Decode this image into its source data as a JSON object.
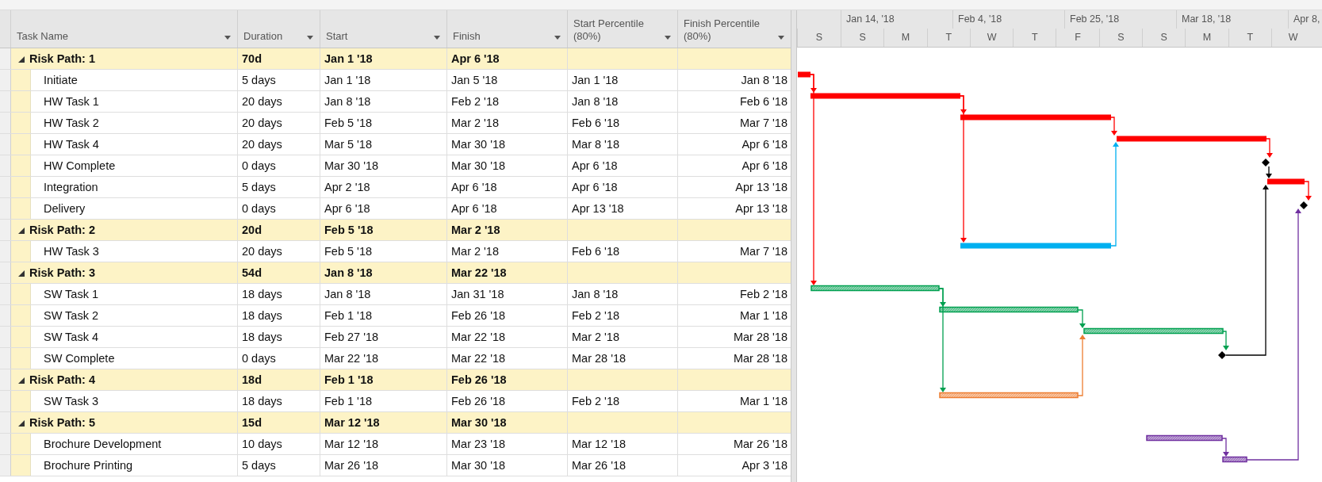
{
  "columns": [
    {
      "label": "Task Name"
    },
    {
      "label": "Duration"
    },
    {
      "label": "Start"
    },
    {
      "label": "Finish"
    },
    {
      "label": "Start Percentile",
      "sublabel": "(80%)"
    },
    {
      "label": "Finish Percentile",
      "sublabel": "(80%)"
    }
  ],
  "timescale": {
    "major": [
      "Jan 14, '18",
      "Feb 4, '18",
      "Feb 25, '18",
      "Mar 18, '18",
      "Apr 8,"
    ],
    "minor": [
      "S",
      "S",
      "M",
      "T",
      "W",
      "T",
      "F",
      "S",
      "S",
      "M",
      "T",
      "W"
    ]
  },
  "groups": [
    {
      "name": "Risk Path: 1",
      "duration": "70d",
      "start": "Jan 1 '18",
      "finish": "Apr 6 '18",
      "expanded": true,
      "color": "#ff0000",
      "hatched": false,
      "tasks": [
        {
          "name": "Initiate",
          "duration": "5 days",
          "start": "Jan 1 '18",
          "finish": "Jan 5 '18",
          "start_percentile": "Jan 1 '18",
          "finish_percentile": "Jan 8 '18"
        },
        {
          "name": "HW Task 1",
          "duration": "20 days",
          "start": "Jan 8 '18",
          "finish": "Feb 2 '18",
          "start_percentile": "Jan 8 '18",
          "finish_percentile": "Feb 6 '18"
        },
        {
          "name": "HW Task 2",
          "duration": "20 days",
          "start": "Feb 5 '18",
          "finish": "Mar 2 '18",
          "start_percentile": "Feb 6 '18",
          "finish_percentile": "Mar 7 '18"
        },
        {
          "name": "HW Task 4",
          "duration": "20 days",
          "start": "Mar 5 '18",
          "finish": "Mar 30 '18",
          "start_percentile": "Mar 8 '18",
          "finish_percentile": "Apr 6 '18"
        },
        {
          "name": "HW Complete",
          "duration": "0 days",
          "start": "Mar 30 '18",
          "finish": "Mar 30 '18",
          "start_percentile": "Apr 6 '18",
          "finish_percentile": "Apr 6 '18"
        },
        {
          "name": "Integration",
          "duration": "5 days",
          "start": "Apr 2 '18",
          "finish": "Apr 6 '18",
          "start_percentile": "Apr 6 '18",
          "finish_percentile": "Apr 13 '18"
        },
        {
          "name": "Delivery",
          "duration": "0 days",
          "start": "Apr 6 '18",
          "finish": "Apr 6 '18",
          "start_percentile": "Apr 13 '18",
          "finish_percentile": "Apr 13 '18"
        }
      ]
    },
    {
      "name": "Risk Path: 2",
      "duration": "20d",
      "start": "Feb 5 '18",
      "finish": "Mar 2 '18",
      "expanded": true,
      "color": "#00b0f0",
      "hatched": false,
      "tasks": [
        {
          "name": "HW Task 3",
          "duration": "20 days",
          "start": "Feb 5 '18",
          "finish": "Mar 2 '18",
          "start_percentile": "Feb 6 '18",
          "finish_percentile": "Mar 7 '18"
        }
      ]
    },
    {
      "name": "Risk Path: 3",
      "duration": "54d",
      "start": "Jan 8 '18",
      "finish": "Mar 22 '18",
      "expanded": true,
      "color": "#00a050",
      "hatched": true,
      "tasks": [
        {
          "name": "SW Task 1",
          "duration": "18 days",
          "start": "Jan 8 '18",
          "finish": "Jan 31 '18",
          "start_percentile": "Jan 8 '18",
          "finish_percentile": "Feb 2 '18"
        },
        {
          "name": "SW Task 2",
          "duration": "18 days",
          "start": "Feb 1 '18",
          "finish": "Feb 26 '18",
          "start_percentile": "Feb 2 '18",
          "finish_percentile": "Mar 1 '18"
        },
        {
          "name": "SW Task 4",
          "duration": "18 days",
          "start": "Feb 27 '18",
          "finish": "Mar 22 '18",
          "start_percentile": "Mar 2 '18",
          "finish_percentile": "Mar 28 '18"
        },
        {
          "name": "SW Complete",
          "duration": "0 days",
          "start": "Mar 22 '18",
          "finish": "Mar 22 '18",
          "start_percentile": "Mar 28 '18",
          "finish_percentile": "Mar 28 '18"
        }
      ]
    },
    {
      "name": "Risk Path: 4",
      "duration": "18d",
      "start": "Feb 1 '18",
      "finish": "Feb 26 '18",
      "expanded": true,
      "color": "#ed7d31",
      "hatched": true,
      "tasks": [
        {
          "name": "SW Task 3",
          "duration": "18 days",
          "start": "Feb 1 '18",
          "finish": "Feb 26 '18",
          "start_percentile": "Feb 2 '18",
          "finish_percentile": "Mar 1 '18"
        }
      ]
    },
    {
      "name": "Risk Path: 5",
      "duration": "15d",
      "start": "Mar 12 '18",
      "finish": "Mar 30 '18",
      "expanded": true,
      "color": "#7030a0",
      "hatched": true,
      "tasks": [
        {
          "name": "Brochure Development",
          "duration": "10 days",
          "start": "Mar 12 '18",
          "finish": "Mar 23 '18",
          "start_percentile": "Mar 12 '18",
          "finish_percentile": "Mar 26 '18"
        },
        {
          "name": "Brochure Printing",
          "duration": "5 days",
          "start": "Mar 26 '18",
          "finish": "Mar 30 '18",
          "start_percentile": "Mar 26 '18",
          "finish_percentile": "Apr 3 '18"
        }
      ]
    }
  ]
}
